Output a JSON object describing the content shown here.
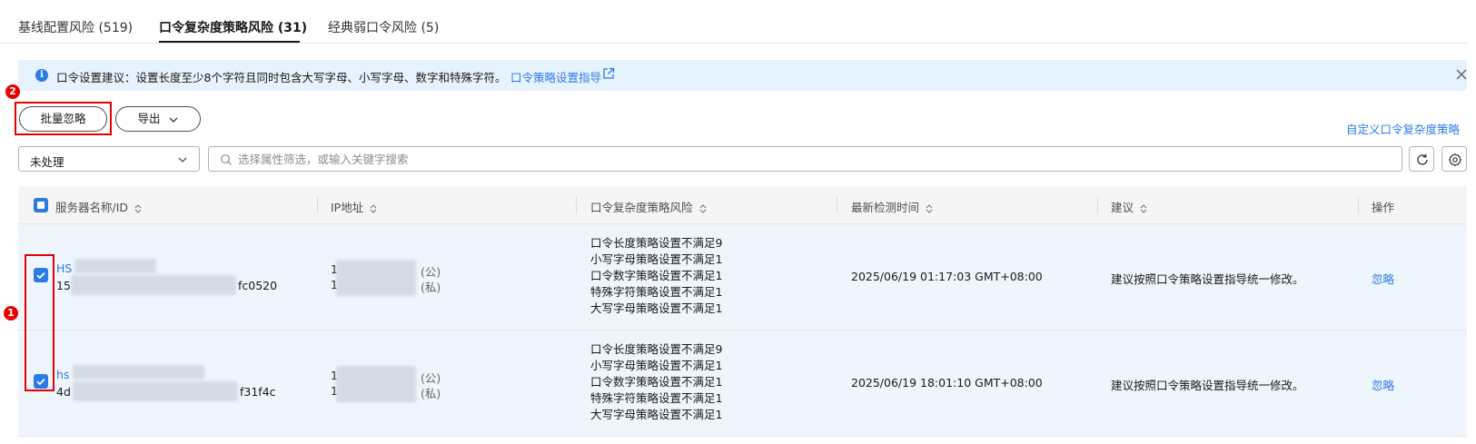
{
  "tabs": [
    {
      "label": "基线配置风险 (519)"
    },
    {
      "label": "口令复杂度策略风险 (31)",
      "active": true
    },
    {
      "label": "经典弱口令风险 (5)"
    }
  ],
  "alert": {
    "text": "口令设置建议：设置长度至少8个字符且同时包含大写字母、小写字母、数字和特殊字符。",
    "link": "口令策略设置指导"
  },
  "badges": {
    "checkbox_callout": "1",
    "button_callout": "2"
  },
  "toolbar": {
    "batch_ignore": "批量忽略",
    "export": "导出",
    "custom_policy_link": "自定义口令复杂度策略"
  },
  "filter": {
    "status_value": "未处理",
    "search_placeholder": "选择属性筛选，或输入关键字搜索"
  },
  "table": {
    "headers": [
      "服务器名称/ID",
      "IP地址",
      "口令复杂度策略风险",
      "最新检测时间",
      "建议",
      "操作"
    ],
    "rows": [
      {
        "name": "HS",
        "id_prefix": "15",
        "id_suffix": "fc0520",
        "ip_public_prefix": "1",
        "ip_public_tag": "(公)",
        "ip_private_prefix": "1",
        "ip_private_tag": "(私)",
        "risks": [
          "口令长度策略设置不满足9",
          "小写字母策略设置不满足1",
          "口令数字策略设置不满足1",
          "特殊字符策略设置不满足1",
          "大写字母策略设置不满足1"
        ],
        "time": "2025/06/19 01:17:03 GMT+08:00",
        "advice": "建议按照口令策略设置指导统一修改。",
        "action": "忽略",
        "checked": true
      },
      {
        "name": "hs",
        "id_prefix": "4d",
        "id_suffix": "f31f4c",
        "ip_public_prefix": "1",
        "ip_public_tag": "(公)",
        "ip_private_prefix": "1",
        "ip_private_tag": "(私)",
        "risks": [
          "口令长度策略设置不满足9",
          "小写字母策略设置不满足1",
          "口令数字策略设置不满足1",
          "特殊字符策略设置不满足1",
          "大写字母策略设置不满足1"
        ],
        "time": "2025/06/19 18:01:10 GMT+08:00",
        "advice": "建议按照口令策略设置指导统一修改。",
        "action": "忽略",
        "checked": true
      }
    ]
  },
  "colors": {
    "accent": "#2c7be5",
    "highlight": "#e60000",
    "row_selected": "#eef5fd"
  }
}
